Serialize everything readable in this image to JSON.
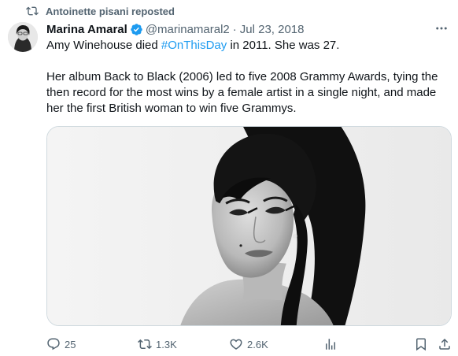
{
  "repost": {
    "icon": "repost-icon",
    "text": "Antoinette pisani reposted"
  },
  "author": {
    "name": "Marina Amaral",
    "handle": "@marinamaral2",
    "separator": "·",
    "date": "Jul 23, 2018",
    "verified_icon": "verified-badge-icon"
  },
  "tweet": {
    "line1_before": "Amy Winehouse died ",
    "hashtag": "#OnThisDay",
    "line1_after": " in 2011. She was 27.",
    "paragraph2": "Her album Back to Black (2006) led to five 2008 Grammy Awards, tying the then record for the most wins by a female artist in a single night, and made her the first British woman to win five Grammys."
  },
  "actions": {
    "reply_count": "25",
    "repost_count": "1.3K",
    "like_count": "2.6K"
  },
  "colors": {
    "accent": "#1d9bf0",
    "muted": "#536471",
    "text": "#0f1419",
    "border": "#cfd9de"
  }
}
